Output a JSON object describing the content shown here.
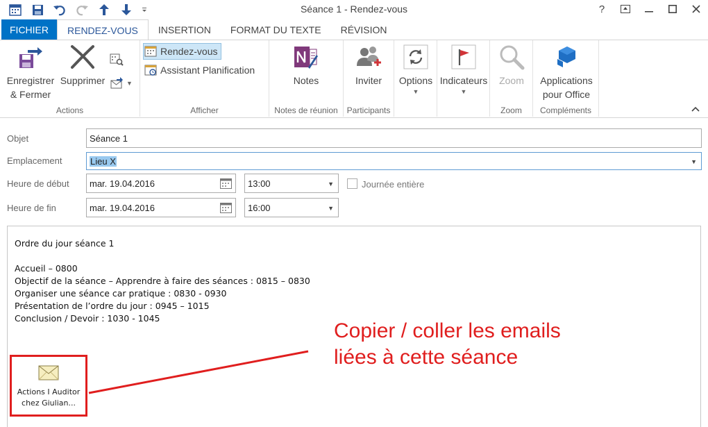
{
  "window": {
    "title": "Séance 1  - Rendez-vous",
    "help": "?",
    "controls": {
      "ribbon_display": "↥",
      "minimize": "—",
      "maximize": "☐",
      "close": "✕"
    }
  },
  "tabs": [
    {
      "label": "FICHIER"
    },
    {
      "label": "RENDEZ-VOUS"
    },
    {
      "label": "INSERTION"
    },
    {
      "label": "FORMAT DU TEXTE"
    },
    {
      "label": "RÉVISION"
    }
  ],
  "ribbon": {
    "actions": {
      "label": "Actions",
      "save_close_line1": "Enregistrer",
      "save_close_line2": "& Fermer",
      "delete": "Supprimer"
    },
    "afficher": {
      "label": "Afficher",
      "appointment": "Rendez-vous",
      "scheduling": "Assistant Planification"
    },
    "notes": {
      "label": "Notes de réunion",
      "button": "Notes"
    },
    "participants": {
      "label": "Participants",
      "button": "Inviter"
    },
    "options": {
      "button": "Options"
    },
    "indicators": {
      "button": "Indicateurs"
    },
    "zoom": {
      "label": "Zoom",
      "button": "Zoom"
    },
    "complements": {
      "label": "Compléments",
      "button_line1": "Applications",
      "button_line2": "pour Office"
    }
  },
  "form": {
    "subject_label": "Objet",
    "subject_value": "Séance 1",
    "location_label": "Emplacement",
    "location_value": "Lieu X",
    "start_label": "Heure de début",
    "start_date": "mar. 19.04.2016",
    "start_time": "13:00",
    "allday_label": "Journée entière",
    "end_label": "Heure de fin",
    "end_date": "mar. 19.04.2016",
    "end_time": "16:00"
  },
  "body": {
    "lines": [
      "Ordre du jour séance 1",
      "Accueil – 0800",
      "Objectif de la séance – Apprendre à faire des séances :  0815 – 0830",
      "Organiser une séance car pratique :  0830 - 0930",
      "Présentation de l’ordre du jour : 0945 – 1015",
      "Conclusion / Devoir : 1030 - 1045"
    ],
    "attachment_line1": "Actions I Auditor",
    "attachment_line2": "chez Giulian..."
  },
  "annotation": {
    "line1": "Copier / coller les emails",
    "line2": "liées à cette séance",
    "color": "#e01e1e"
  },
  "colors": {
    "file_tab": "#0072c6",
    "accent": "#2b579a",
    "selection": "#99c9ef"
  }
}
